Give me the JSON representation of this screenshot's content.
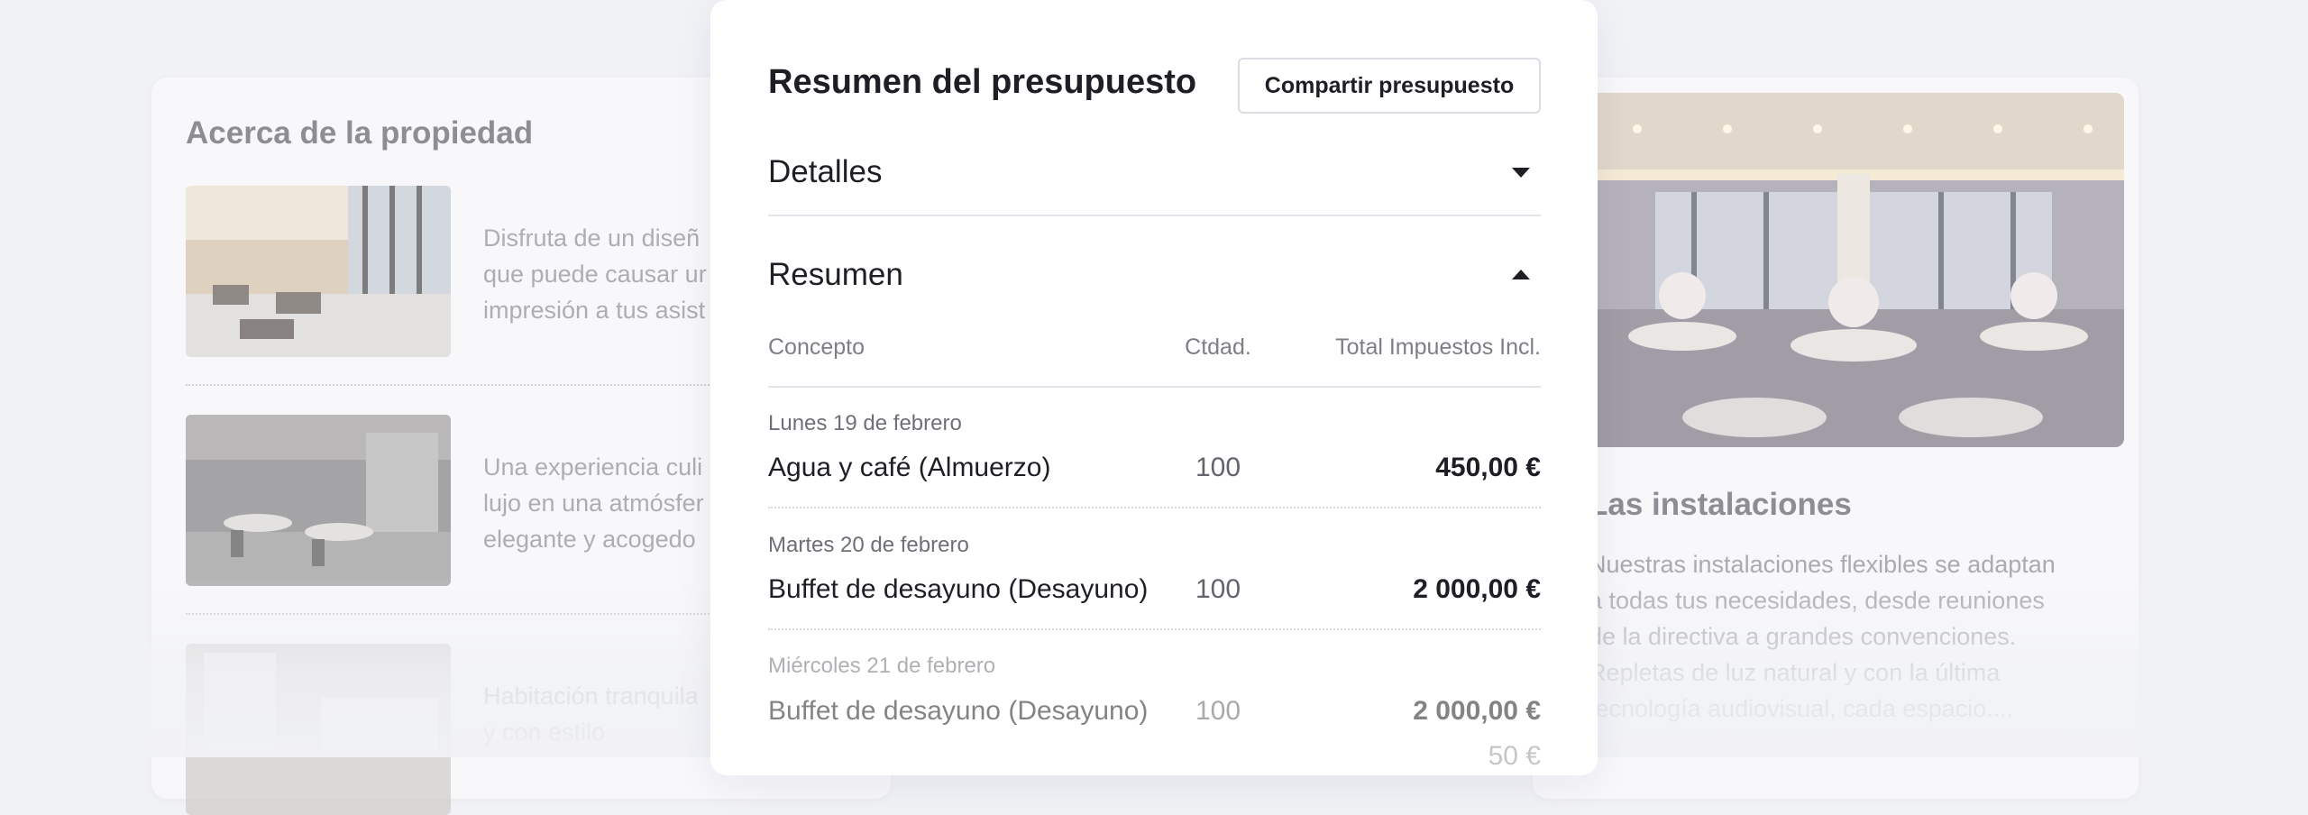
{
  "background": {
    "left_card": {
      "title": "Acerca de la propiedad",
      "items": [
        {
          "text": "Disfruta de un diseñ\nque puede causar ur\nimpresión a tus asist"
        },
        {
          "text": "Una experiencia culi\nlujo en una atmósfer\nelegante y acogedo"
        },
        {
          "text": "Habitación tranquila\ny con estilo"
        }
      ]
    },
    "right_card": {
      "title": "Las instalaciones",
      "description": "Nuestras instalaciones flexibles se adaptan\na todas tus necesidades, desde reuniones\nde la directiva a grandes convenciones.\nRepletas de luz natural y con la última\ntecnología audiovisual, cada espacio...."
    }
  },
  "modal": {
    "title": "Resumen del presupuesto",
    "share_label": "Compartir presupuesto",
    "details_label": "Detalles",
    "summary_label": "Resumen",
    "columns": {
      "concept": "Concepto",
      "qty": "Ctdad.",
      "total": "Total Impuestos Incl."
    },
    "rows": [
      {
        "date": "Lunes 19 de febrero",
        "concept": "Agua y café (Almuerzo)",
        "qty": "100",
        "total": "450,00 €"
      },
      {
        "date": "Martes 20 de febrero",
        "concept": "Buffet de desayuno (Desayuno)",
        "qty": "100",
        "total": "2 000,00 €"
      },
      {
        "date": "Miércoles 21 de febrero",
        "concept": "Buffet de desayuno (Desayuno)",
        "qty": "100",
        "total": "2 000,00 €"
      }
    ],
    "partial_total": "50 €"
  },
  "icons": {
    "details_toggle": "caret-down-icon",
    "summary_toggle": "caret-up-icon"
  }
}
